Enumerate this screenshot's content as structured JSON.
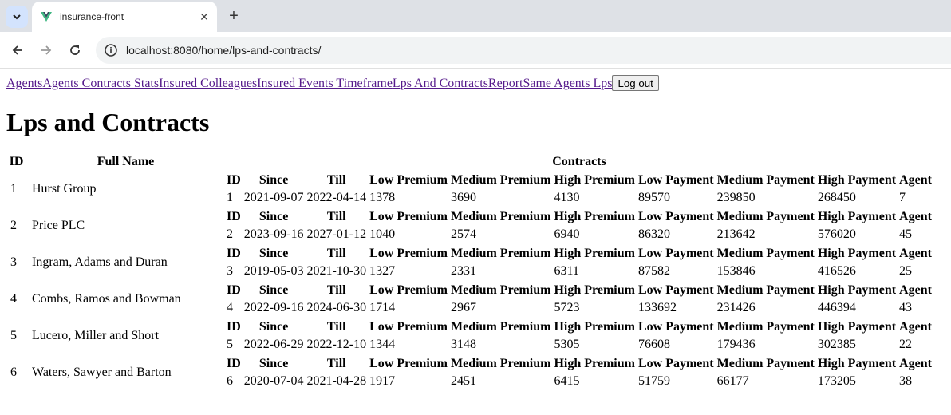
{
  "browser": {
    "tab_title": "insurance-front",
    "url": "localhost:8080/home/lps-and-contracts/"
  },
  "nav": {
    "links": [
      "Agents",
      "Agents Contracts Stats",
      "Insured Colleagues",
      "Insured Events Timeframe",
      "Lps And Contracts",
      "Report",
      "Same Agents Lps"
    ],
    "logout_label": "Log out"
  },
  "page_title": "Lps and Contracts",
  "table": {
    "headers": {
      "id": "ID",
      "full_name": "Full Name",
      "contracts": "Contracts"
    },
    "contract_headers": [
      "ID",
      "Since",
      "Till",
      "Low Premium",
      "Medium Premium",
      "High Premium",
      "Low Payment",
      "Medium Payment",
      "High Payment",
      "Agent"
    ],
    "rows": [
      {
        "id": "1",
        "name": "Hurst Group",
        "contract": [
          "1",
          "2021-09-07",
          "2022-04-14",
          "1378",
          "3690",
          "4130",
          "89570",
          "239850",
          "268450",
          "7"
        ]
      },
      {
        "id": "2",
        "name": "Price PLC",
        "contract": [
          "2",
          "2023-09-16",
          "2027-01-12",
          "1040",
          "2574",
          "6940",
          "86320",
          "213642",
          "576020",
          "45"
        ]
      },
      {
        "id": "3",
        "name": "Ingram, Adams and Duran",
        "contract": [
          "3",
          "2019-05-03",
          "2021-10-30",
          "1327",
          "2331",
          "6311",
          "87582",
          "153846",
          "416526",
          "25"
        ]
      },
      {
        "id": "4",
        "name": "Combs, Ramos and Bowman",
        "contract": [
          "4",
          "2022-09-16",
          "2024-06-30",
          "1714",
          "2967",
          "5723",
          "133692",
          "231426",
          "446394",
          "43"
        ]
      },
      {
        "id": "5",
        "name": "Lucero, Miller and Short",
        "contract": [
          "5",
          "2022-06-29",
          "2022-12-10",
          "1344",
          "3148",
          "5305",
          "76608",
          "179436",
          "302385",
          "22"
        ]
      },
      {
        "id": "6",
        "name": "Waters, Sawyer and Barton",
        "contract": [
          "6",
          "2020-07-04",
          "2021-04-28",
          "1917",
          "2451",
          "6415",
          "51759",
          "66177",
          "173205",
          "38"
        ]
      }
    ]
  }
}
